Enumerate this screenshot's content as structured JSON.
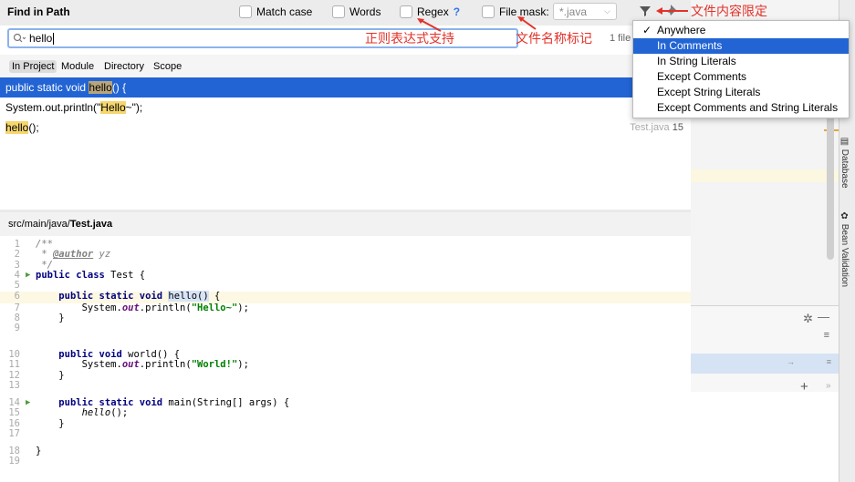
{
  "header": {
    "title": "Find in Path",
    "match_case": "Match case",
    "words": "Words",
    "regex": "Regex",
    "regex_help": "?",
    "file_mask": "File mask:",
    "file_mask_value": "*.java",
    "match_count": "1 file"
  },
  "search": {
    "value": "hello"
  },
  "scopes": [
    "In Project",
    "Module",
    "Directory",
    "Scope"
  ],
  "results": {
    "r1": {
      "pre": "public static void ",
      "hit": "hello",
      "post": "() {"
    },
    "r2": {
      "pre": "System.out.println(\"",
      "hit": "Hello",
      "post": "~\");"
    },
    "r3": {
      "hit": "hello",
      "post": "();",
      "file": "Test.java",
      "line": "15"
    }
  },
  "preview": {
    "path_prefix": "src/main/java/",
    "file_name": "Test.java"
  },
  "popup": {
    "items": [
      "Anywhere",
      "In Comments",
      "In String Literals",
      "Except Comments",
      "Except String Literals",
      "Except Comments and String Literals"
    ],
    "selected_index": 1,
    "checked_index": 0
  },
  "annotations": {
    "regex_note": "正则表达式支持",
    "mask_note": "文件名称标记",
    "content_note": "文件内容限定"
  },
  "right_panel": {
    "tab_database": "Database",
    "tab_bean": "Bean Validation"
  },
  "colors": {
    "selection": "#2264d3",
    "annotation": "#e2322a",
    "highlight": "#f5d66f"
  }
}
